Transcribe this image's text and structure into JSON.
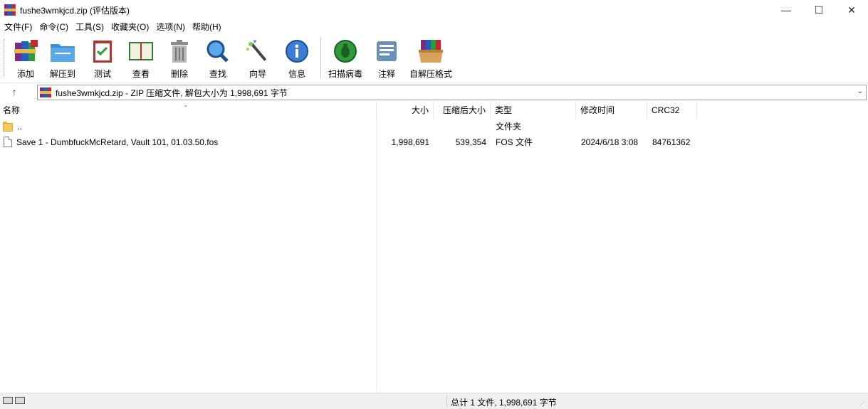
{
  "window": {
    "title": "fushe3wmkjcd.zip (评估版本)",
    "controls": {
      "minimize": "—",
      "maximize": "☐",
      "close": "✕"
    }
  },
  "menu": [
    "文件(F)",
    "命令(C)",
    "工具(S)",
    "收藏夹(O)",
    "选项(N)",
    "帮助(H)"
  ],
  "toolbar": {
    "add": "添加",
    "extract_to": "解压到",
    "test": "测试",
    "view": "查看",
    "delete": "删除",
    "find": "查找",
    "wizard": "向导",
    "info": "信息",
    "virus_scan": "扫描病毒",
    "comment": "注释",
    "sfx": "自解压格式"
  },
  "address": {
    "up": "↑",
    "text": "fushe3wmkjcd.zip - ZIP 压缩文件, 解包大小为 1,998,691 字节",
    "dropdown": "⌄"
  },
  "columns": {
    "name": "名称",
    "size": "大小",
    "packed": "压缩后大小",
    "type": "类型",
    "modified": "修改时间",
    "crc": "CRC32"
  },
  "rows": [
    {
      "name": "..",
      "size": "",
      "packed": "",
      "type": "文件夹",
      "modified": "",
      "crc": ""
    },
    {
      "name": "Save 1 - DumbfuckMcRetard, Vault 101, 01.03.50.fos",
      "size": "1,998,691",
      "packed": "539,354",
      "type": "FOS 文件",
      "modified": "2024/6/18 3:08",
      "crc": "84761362"
    }
  ],
  "status": {
    "summary": "总计 1 文件, 1,998,691 字节"
  }
}
